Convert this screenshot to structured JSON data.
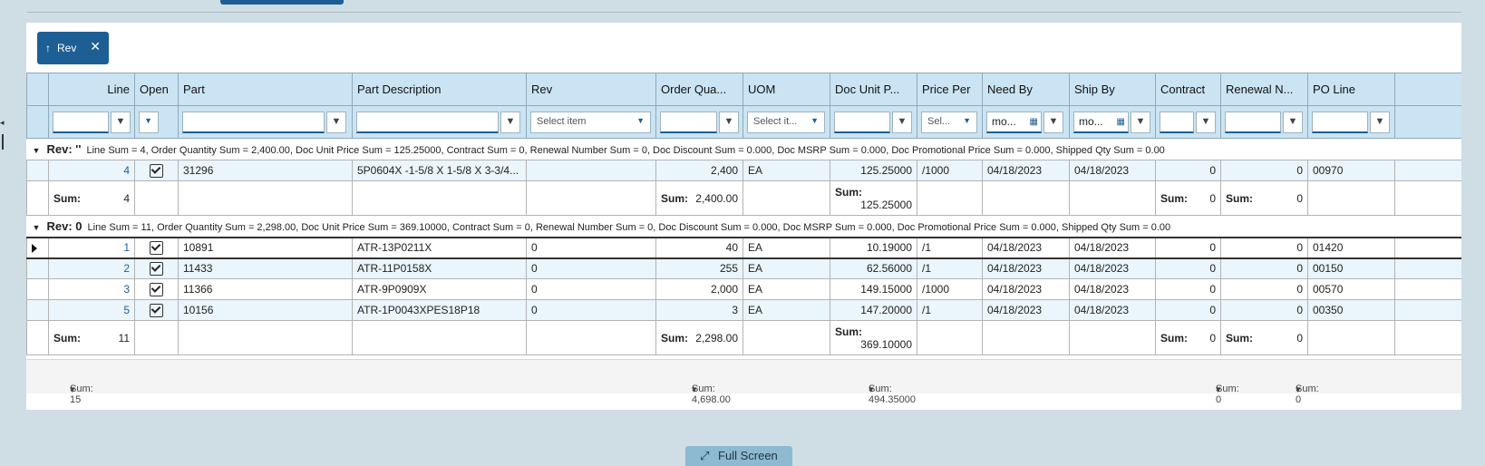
{
  "filter_chip": {
    "label": "Rev",
    "arrow": "↑",
    "close": "✕"
  },
  "columns": [
    "Line",
    "Open",
    "Part",
    "Part Description",
    "Rev",
    "Order Qua...",
    "UOM",
    "Doc Unit P...",
    "Price Per",
    "Need By",
    "Ship By",
    "Contract",
    "Renewal N...",
    "PO Line",
    ""
  ],
  "filters": {
    "rev_placeholder": "Select item",
    "uom_placeholder": "Select it...",
    "priceper_placeholder": "Sel...",
    "needby_value": "mo...",
    "shipby_value": "mo..."
  },
  "groups": [
    {
      "label": "Rev: ''",
      "summary": "Line Sum = 4, Order Quantity Sum = 2,400.00, Doc Unit Price Sum = 125.25000, Contract Sum = 0, Renewal Number Sum = 0, Doc Discount Sum = 0.000, Doc MSRP Sum = 0.000, Doc Promotional Price Sum = 0.000, Shipped Qty Sum = 0.00",
      "rows": [
        {
          "line": "4",
          "part": "31296",
          "desc": "5P0604X -1-5/8 X 1-5/8 X 3-3/4...",
          "rev": "",
          "qty": "2,400",
          "uom": "EA",
          "price": "125.25000",
          "per": "/1000",
          "need": "04/18/2023",
          "ship": "04/18/2023",
          "contract": "0",
          "renewal": "0",
          "poline": "00970"
        }
      ],
      "sums": {
        "label": "Sum:",
        "line": "4",
        "qty": "2,400.00",
        "price": "125.25000",
        "contract": "0",
        "renewal": "0"
      }
    },
    {
      "label": "Rev: 0",
      "summary": "Line Sum = 11, Order Quantity Sum = 2,298.00, Doc Unit Price Sum = 369.10000, Contract Sum = 0, Renewal Number Sum = 0, Doc Discount Sum = 0.000, Doc MSRP Sum = 0.000, Doc Promotional Price Sum = 0.000, Shipped Qty Sum = 0.00",
      "rows": [
        {
          "line": "1",
          "part": "10891",
          "desc": "ATR-13P0211X",
          "rev": "0",
          "qty": "40",
          "uom": "EA",
          "price": "10.19000",
          "per": "/1",
          "need": "04/18/2023",
          "ship": "04/18/2023",
          "contract": "0",
          "renewal": "0",
          "poline": "01420"
        },
        {
          "line": "2",
          "part": "11433",
          "desc": "ATR-11P0158X",
          "rev": "0",
          "qty": "255",
          "uom": "EA",
          "price": "62.56000",
          "per": "/1",
          "need": "04/18/2023",
          "ship": "04/18/2023",
          "contract": "0",
          "renewal": "0",
          "poline": "00150"
        },
        {
          "line": "3",
          "part": "11366",
          "desc": "ATR-9P0909X",
          "rev": "0",
          "qty": "2,000",
          "uom": "EA",
          "price": "149.15000",
          "per": "/1000",
          "need": "04/18/2023",
          "ship": "04/18/2023",
          "contract": "0",
          "renewal": "0",
          "poline": "00570"
        },
        {
          "line": "5",
          "part": "10156",
          "desc": "ATR-1P0043XPES18P18",
          "rev": "0",
          "qty": "3",
          "uom": "EA",
          "price": "147.20000",
          "per": "/1",
          "need": "04/18/2023",
          "ship": "04/18/2023",
          "contract": "0",
          "renewal": "0",
          "poline": "00350"
        }
      ],
      "sums": {
        "label": "Sum:",
        "line": "11",
        "qty": "2,298.00",
        "price": "369.10000",
        "contract": "0",
        "renewal": "0"
      }
    }
  ],
  "footer": {
    "line_total": "Sum: 15",
    "qty_total": "Sum: 4,698.00",
    "price_total": "Sum: 494.35000",
    "contract_total": "Sum: 0",
    "renewal_total": "Sum: 0",
    "caret": "▾"
  },
  "full_screen": {
    "label": "Full Screen",
    "icon": "⤢"
  },
  "icons": {
    "filter": "filter-icon",
    "dropdown": "chevron-down-icon",
    "calendar": "calendar-icon",
    "expand": "triangle-down-icon"
  },
  "colors": {
    "header_bg": "#cbe4f3",
    "accent": "#1d5f95",
    "alt_row": "#eaf5fc",
    "page_bg": "#cfdde4"
  }
}
